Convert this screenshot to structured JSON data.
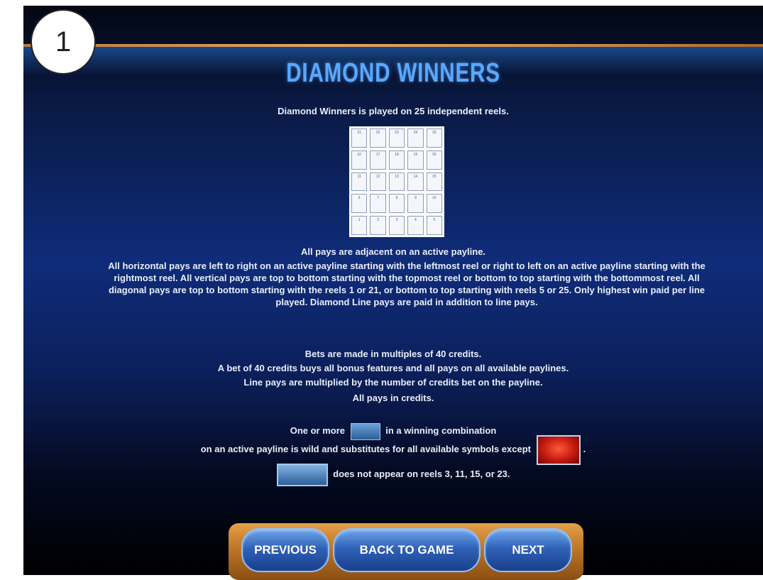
{
  "badge": "1",
  "title": "DIAMOND WINNERS",
  "intro": "Diamond Winners is played on 25 independent reels.",
  "reel_grid": {
    "labels": [
      "21",
      "22",
      "23",
      "24",
      "25",
      "16",
      "17",
      "18",
      "19",
      "20",
      "11",
      "12",
      "13",
      "14",
      "15",
      "6",
      "7",
      "8",
      "9",
      "10",
      "1",
      "2",
      "3",
      "4",
      "5"
    ]
  },
  "rules": {
    "line1": "All pays are adjacent on an active payline.",
    "paragraph": "All horizontal pays are left to right on an active payline starting with the leftmost reel or right to left on an active payline starting with the rightmost reel.  All vertical pays are top to bottom starting with the topmost reel or bottom to top starting with the bottommost reel. All diagonal pays are top to bottom starting with the reels 1 or 21, or bottom to top starting with reels 5 or 25.  Only highest win paid per line played.  Diamond Line pays are paid in addition to line pays.",
    "bet1": "Bets are made in multiples of 40 credits.",
    "bet2": "A bet of 40 credits buys all bonus features and all pays on all available paylines.",
    "bet3": "Line pays are multiplied by the number of credits bet on the payline.",
    "bet4": "All pays in credits."
  },
  "wild": {
    "line1_pre": "One or more",
    "line1_post": "in a winning combination",
    "line2": "on an active payline is wild and substitutes for all available symbols except",
    "line2_end": ".",
    "line3": "does not appear on reels 3, 11, 15, or 23."
  },
  "nav": {
    "previous": "PREVIOUS",
    "back": "BACK TO GAME",
    "next": "NEXT"
  },
  "colors": {
    "title": "#5aa8ff",
    "accent_line": "#e8a35a",
    "button": "#2f62b8"
  }
}
